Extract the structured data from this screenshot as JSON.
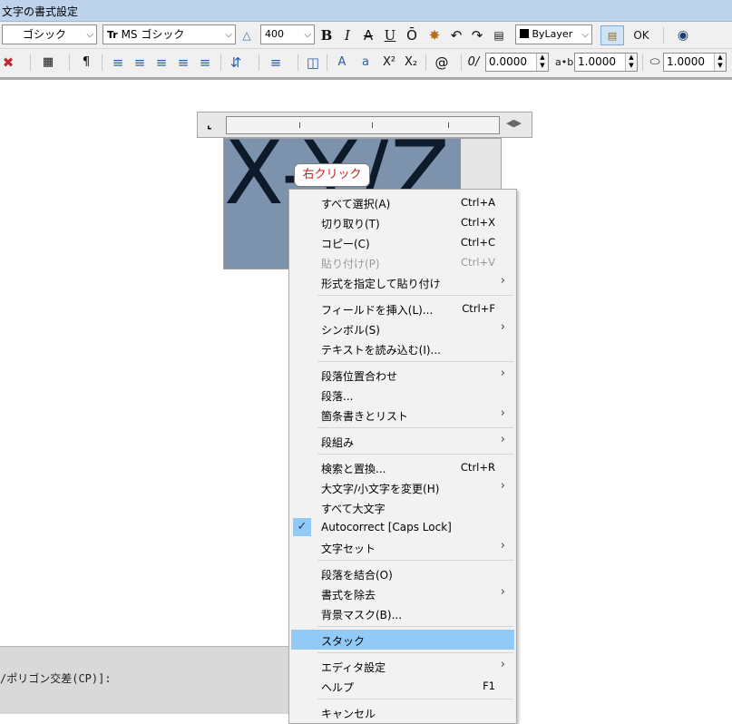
{
  "window": {
    "title": "文字の書式設定"
  },
  "toolbar": {
    "style_value": "ゴシック",
    "font_value": "MS ゴシック",
    "font_prefix": "Tr",
    "height_value": "400",
    "bold": "B",
    "italic": "I",
    "strike": "A",
    "underline": "U",
    "overline": "Ō",
    "color_value": "ByLayer",
    "ok_label": "OK",
    "oblique_value": "0.0000",
    "tracking_value": "1.0000",
    "width_value": "1.0000",
    "tracking_prefix": "a•b",
    "oblique_prefix": "0/",
    "upper_a": "A",
    "lower_a": "a"
  },
  "canvas": {
    "editor_text": "X-Y/Z",
    "callout": "右クリック",
    "command_prompt": "/ポリゴン交差(CP)]:"
  },
  "context_menu": {
    "items": [
      {
        "label": "すべて選択(A)",
        "shortcut": "Ctrl+A"
      },
      {
        "label": "切り取り(T)",
        "shortcut": "Ctrl+X"
      },
      {
        "label": "コピー(C)",
        "shortcut": "Ctrl+C"
      },
      {
        "label": "貼り付け(P)",
        "shortcut": "Ctrl+V"
      },
      {
        "label": "形式を指定して貼り付け"
      },
      {
        "label": "フィールドを挿入(L)...",
        "shortcut": "Ctrl+F"
      },
      {
        "label": "シンボル(S)"
      },
      {
        "label": "テキストを読み込む(I)..."
      },
      {
        "label": "段落位置合わせ"
      },
      {
        "label": "段落..."
      },
      {
        "label": "箇条書きとリスト"
      },
      {
        "label": "段組み"
      },
      {
        "label": "検索と置換...",
        "shortcut": "Ctrl+R"
      },
      {
        "label": "大文字/小文字を変更(H)"
      },
      {
        "label": "すべて大文字"
      },
      {
        "label": "Autocorrect [Caps Lock]"
      },
      {
        "label": "文字セット"
      },
      {
        "label": "段落を結合(O)"
      },
      {
        "label": "書式を除去"
      },
      {
        "label": "背景マスク(B)..."
      },
      {
        "label": "スタック"
      },
      {
        "label": "エディタ設定"
      },
      {
        "label": "ヘルプ",
        "shortcut": "F1"
      },
      {
        "label": "キャンセル"
      }
    ],
    "submenu_arrow": "›",
    "check_mark": "✓"
  },
  "colors": {
    "title_bar": "#bcd3eb",
    "selection": "#7d93ad",
    "menu_highlight": "#91c9f7",
    "callout_text": "#c42020"
  }
}
